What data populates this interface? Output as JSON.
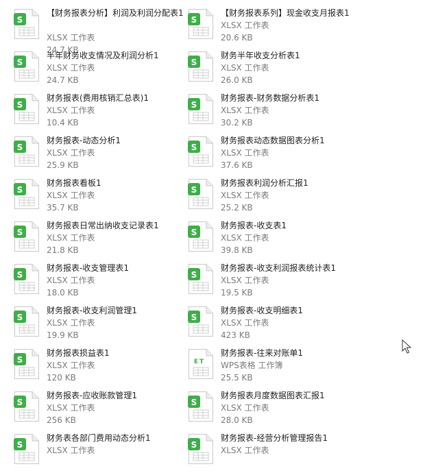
{
  "files": [
    {
      "name": "【财务报表分析】利润及利润分配表1",
      "type": "XLSX 工作表",
      "size": "24.7 KB"
    },
    {
      "name": "【财务报表系列】现金收支月报表1",
      "type": "XLSX 工作表",
      "size": "20.6 KB"
    },
    {
      "name": "半年财务收支情况及利润分析1",
      "type": "XLSX 工作表",
      "size": "24.7 KB"
    },
    {
      "name": "财务半年收支分析表1",
      "type": "XLSX 工作表",
      "size": "26.0 KB"
    },
    {
      "name": "财务报表(费用核销汇总表)1",
      "type": "XLSX 工作表",
      "size": "10.4 KB"
    },
    {
      "name": "财务报表-财务数据分析表1",
      "type": "XLSX 工作表",
      "size": "30.2 KB"
    },
    {
      "name": "财务报表-动态分析1",
      "type": "XLSX 工作表",
      "size": "25.9 KB"
    },
    {
      "name": "财务报表动态数据图表分析1",
      "type": "XLSX 工作表",
      "size": "37.6 KB"
    },
    {
      "name": "财务报表看板1",
      "type": "XLSX 工作表",
      "size": "35.7 KB"
    },
    {
      "name": "财务报表利润分析汇报1",
      "type": "XLSX 工作表",
      "size": "25.2 KB"
    },
    {
      "name": "财务报表日常出纳收支记录表1",
      "type": "XLSX 工作表",
      "size": "21.8 KB"
    },
    {
      "name": "财务报表-收支表1",
      "type": "XLSX 工作表",
      "size": "39.8 KB"
    },
    {
      "name": "财务报表-收支管理表1",
      "type": "XLSX 工作表",
      "size": "18.0 KB"
    },
    {
      "name": "财务报表-收支利润报表统计表1",
      "type": "XLSX 工作表",
      "size": "19.5 KB"
    },
    {
      "name": "财务报表-收支利润管理1",
      "type": "XLSX 工作表",
      "size": "19.9 KB"
    },
    {
      "name": "财务报表-收支明细表1",
      "type": "XLSX 工作表",
      "size": "423 KB"
    },
    {
      "name": "财务报表损益表1",
      "type": "XLSX 工作表",
      "size": "120 KB"
    },
    {
      "name": "财务报表-往来对账单1",
      "type": "WPS表格 工作簿",
      "size": "25.5 KB",
      "icon": "et"
    },
    {
      "name": "财务报表-应收账款管理1",
      "type": "XLSX 工作表",
      "size": "256 KB"
    },
    {
      "name": "财务报表月度数据图表汇报1",
      "type": "XLSX 工作表",
      "size": "28.0 KB"
    },
    {
      "name": "财务表各部门费用动态分析1",
      "type": "XLSX 工作表",
      "size": ""
    },
    {
      "name": "财务报表-经营分析管理报告1",
      "type": "XLSX 工作表",
      "size": ""
    }
  ],
  "icons": {
    "xlsx_badge": "S",
    "et_badge": "ET",
    "xlsx_color": "#3fae49",
    "et_color": "#3fae49"
  }
}
